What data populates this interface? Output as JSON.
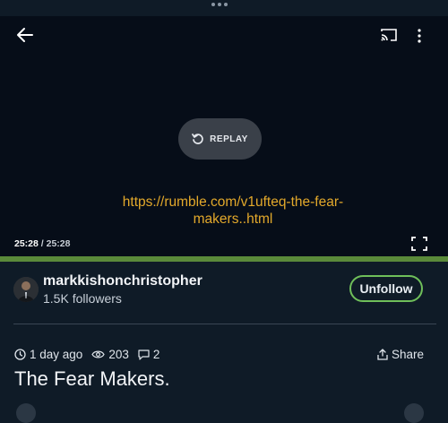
{
  "player": {
    "replay_label": "REPLAY",
    "overlay_url": "https://rumble.com/v1ufteq-the-fear-makers..html",
    "current_time": "25:28",
    "separator": " / ",
    "total_time": "25:28",
    "progress": 1.0,
    "progress_color": "#5a8a3a"
  },
  "channel": {
    "name": "markkishonchristopher",
    "followers": "1.5K followers",
    "follow_button_label": "Unfollow",
    "accent": "#6fbf5a"
  },
  "video": {
    "posted": "1 day ago",
    "views": "203",
    "comments": "2",
    "share_label": "Share",
    "title": "The Fear Makers."
  },
  "icons": [
    "back-arrow-icon",
    "cast-icon",
    "more-vert-icon",
    "replay-icon",
    "fullscreen-icon",
    "clock-icon",
    "eye-icon",
    "comment-icon",
    "share-icon"
  ]
}
